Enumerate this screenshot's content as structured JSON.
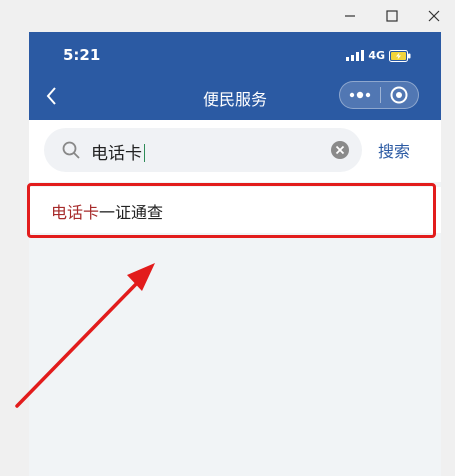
{
  "window_controls": {
    "minimize_icon": "minimize-icon",
    "maximize_icon": "maximize-icon",
    "close_icon": "close-icon"
  },
  "status_bar": {
    "time": "5:21",
    "network": "4G",
    "icons": [
      "signal-icon",
      "battery-charging-icon"
    ]
  },
  "nav": {
    "back_icon": "chevron-left-icon",
    "title": "便民服务",
    "more_icon": "more-dots-icon",
    "close_icon": "target-circle-icon"
  },
  "search": {
    "value": "电话卡",
    "clear_icon": "clear-circle-icon",
    "button_label": "搜索"
  },
  "results": [
    {
      "highlight": "电话卡",
      "rest": "一证通查"
    }
  ],
  "annotation": {
    "box_color": "#e21c1c",
    "arrow_color": "#e21c1c"
  },
  "colors": {
    "brand": "#2b5aa3",
    "highlight_text": "#a62a2a",
    "page_bg": "#f1f4f6"
  }
}
